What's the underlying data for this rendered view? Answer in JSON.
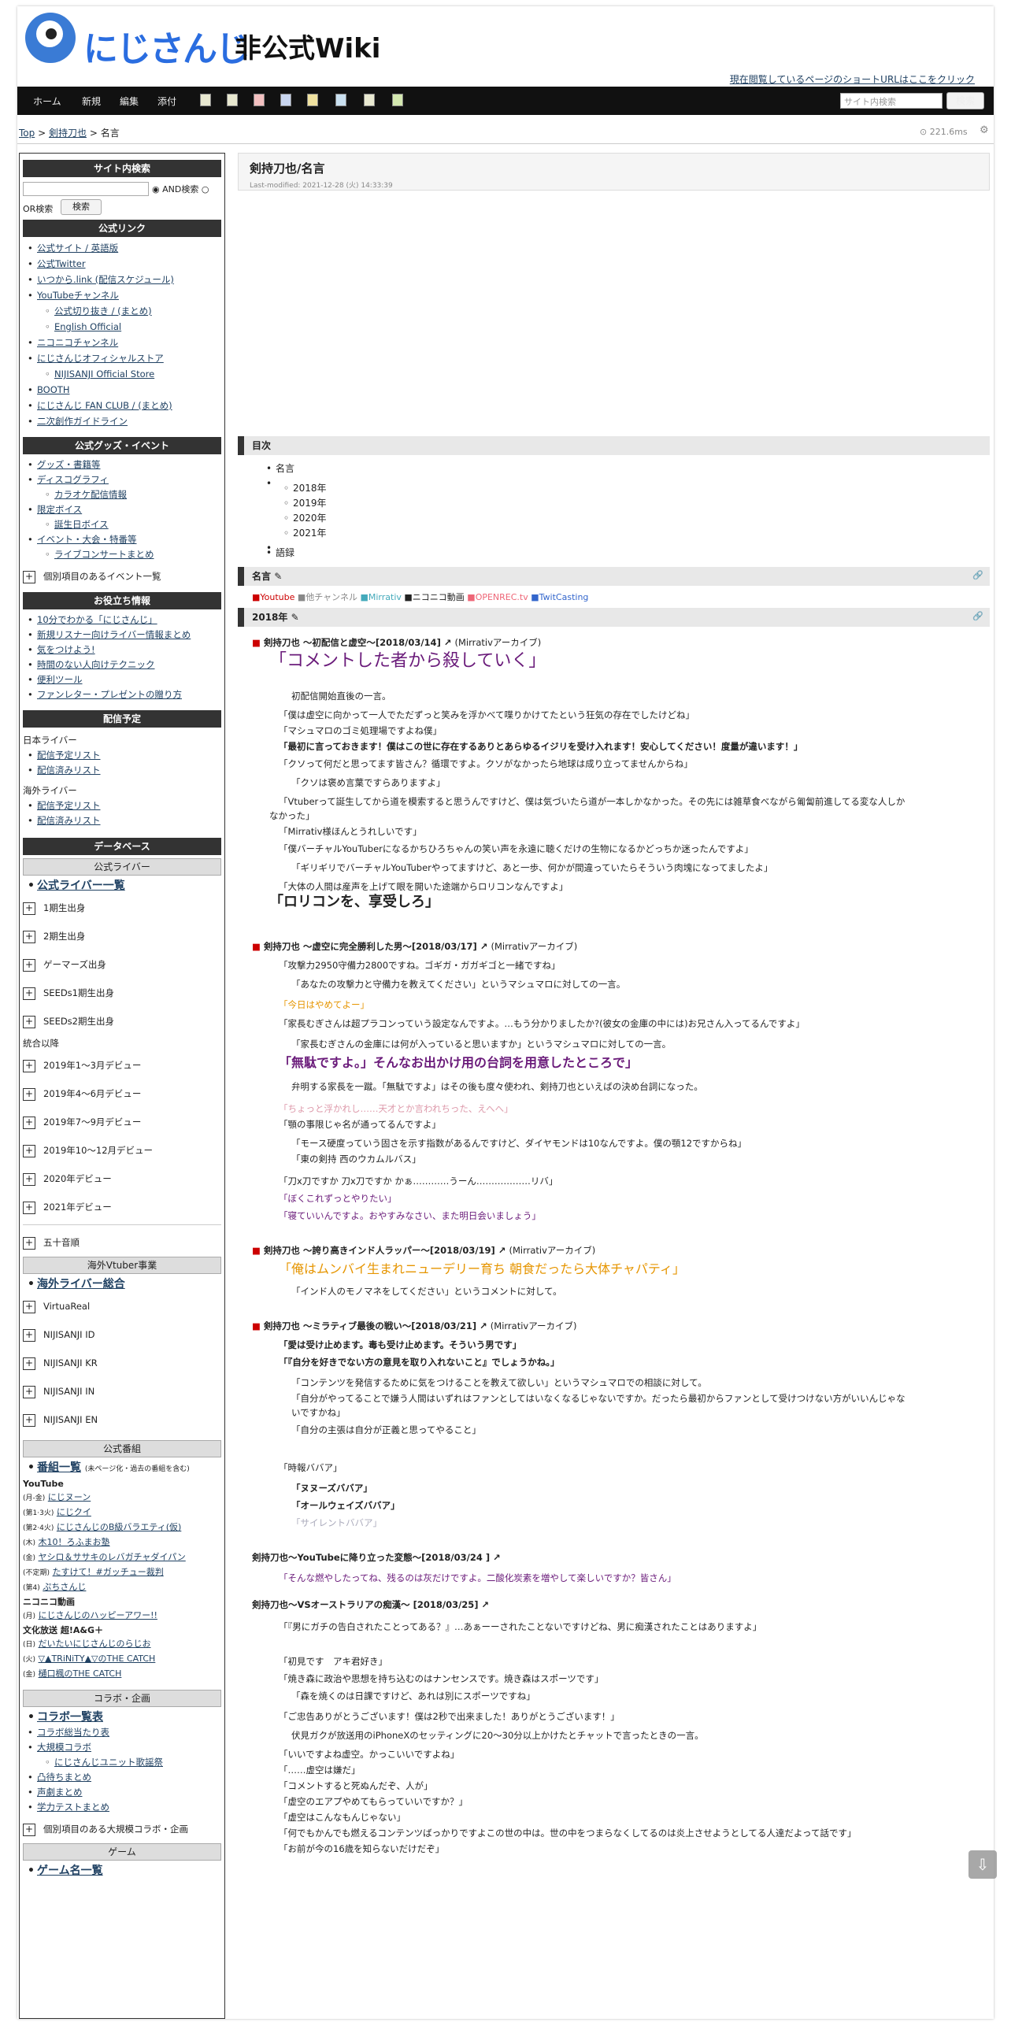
{
  "site": {
    "title_kana": "にじさんじ",
    "title_rest": "非公式Wiki",
    "shorturl": "現在閲覧しているページのショートURLはここをクリック"
  },
  "nav": {
    "items": [
      "ホーム",
      "新規",
      "編集",
      "添付"
    ],
    "search_placeholder": "サイト内検索",
    "search_button": "検索"
  },
  "breadcrumb": {
    "top": "Top",
    "sep": ">",
    "parent": "剣持刀也",
    "current": "名言"
  },
  "perf": "221.6ms",
  "side": {
    "search_title": "サイト内検索",
    "and_label": "AND検索",
    "or_label": "OR検索",
    "search_button": "検索",
    "official_title": "公式リンク",
    "official": [
      "公式サイト / 英語版",
      "公式Twitter",
      "いつから.link (配信スケジュール)",
      "YouTubeチャンネル",
      "公式切り抜き / (まとめ)",
      "English Official",
      "ニコニコチャンネル",
      "にじさんじオフィシャルストア",
      "NIJISANJI Official Store",
      "BOOTH",
      "にじさんじ FAN CLUB / (まとめ)",
      "二次創作ガイドライン"
    ],
    "goods_title": "公式グッズ・イベント",
    "goods": [
      "グッズ・書籍等",
      "ディスコグラフィ",
      "カラオケ配信情報",
      "限定ボイス",
      "誕生日ボイス",
      "イベント・大会・特番等",
      "ライブコンサートまとめ"
    ],
    "goods_exp": "個別項目のあるイベント一覧",
    "info_title": "お役立ち情報",
    "info": [
      "10分でわかる「にじさんじ」",
      "新規リスナー向けライバー情報まとめ",
      "気をつけよう!",
      "時間のない人向けテクニック",
      "便利ツール",
      "ファンレター・プレゼントの贈り方"
    ],
    "sched_title": "配信予定",
    "jp_label": "日本ライバー",
    "overseas_label": "海外ライバー",
    "sched": [
      "配信予定リスト",
      "配信済みリスト"
    ],
    "db_title": "データベース",
    "liver_title": "公式ライバー",
    "liver_all": "公式ライバー一覧",
    "gen": [
      "1期生出身",
      "2期生出身",
      "ゲーマーズ出身",
      "SEEDs1期生出身",
      "SEEDs2期生出身"
    ],
    "merge_label": "統合以降",
    "debut": [
      "2019年1～3月デビュー",
      "2019年4～6月デビュー",
      "2019年7～9月デビュー",
      "2019年10～12月デビュー",
      "2020年デビュー",
      "2021年デビュー"
    ],
    "gojuon": "五十音順",
    "vt_title": "海外Vtuber事業",
    "vt_all": "海外ライバー総合",
    "vt": [
      "VirtuaReal",
      "NIJISANJI ID",
      "NIJISANJI KR",
      "NIJISANJI IN",
      "NIJISANJI EN"
    ],
    "prog_title": "公式番組",
    "prog_all": "番組一覧",
    "prog_note": "(未ページ化・過去の番組を含む)",
    "yt_label": "YouTube",
    "yt": [
      [
        "(月-金)",
        "にじヌーン"
      ],
      [
        "(第1·3火)",
        "にじクイ"
      ],
      [
        "(第2·4火)",
        "にじさんじのB級バラエティ(仮)"
      ],
      [
        "(木)",
        "木10！ろふまお塾"
      ],
      [
        "(金)",
        "ヤシロ＆ササキのレバガチャダイパン"
      ],
      [
        "(不定期)",
        "たすけて！#ガッチュー裁判"
      ],
      [
        "(第4)",
        "ぷちさんじ"
      ]
    ],
    "nico_label": "ニコニコ動画",
    "nico": [
      [
        "(月)",
        "にじさんじのハッピーアワー!!"
      ]
    ],
    "bunka_label": "文化放送 超!A&G＋",
    "bunka": [
      [
        "(日)",
        "だいたいにじさんじのらじお"
      ],
      [
        "(火)",
        "▽▲TRiNiTY▲▽のTHE CATCH"
      ],
      [
        "(金)",
        "樋口楓のTHE CATCH"
      ]
    ],
    "collab_title": "コラボ・企画",
    "collab_all": "コラボ一覧表",
    "collab": [
      "コラボ総当たり表",
      "大規模コラボ",
      "にじさんじユニット歌謡祭",
      "凸待ちまとめ",
      "声劇まとめ",
      "学力テストまとめ"
    ],
    "collab_exp": "個別項目のある大規模コラボ・企画",
    "game_title": "ゲーム",
    "game_all": "ゲーム名一覧"
  },
  "page": {
    "title": "剣持刀也/名言",
    "modified": "Last-modified: 2021-12-28 (火) 14:33:39"
  },
  "toc": {
    "title": "目次",
    "items": [
      "名言",
      "2018年",
      "2019年",
      "2020年",
      "2021年",
      "語録"
    ]
  },
  "legend": [
    "■Youtube",
    "■他チャンネル",
    "■Mirrativ",
    "■ニコニコ動画",
    "■OPENREC.tv",
    "■TwitCasting"
  ],
  "section": "名言",
  "year": "2018年",
  "e1": {
    "title": "剣持刀也 ～初配信と虚空～[2018/03/14]",
    "src": "(Mirrativアーカイブ)",
    "big": "「コメントした者から殺していく」",
    "sub": "初配信開始直後の一言。",
    "l1": "「僕は虚空に向かって一人でただずっと笑みを浮かべて喋りかけてたという狂気の存在でしたけどね」",
    "l2": "「マシュマロのゴミ処理場ですよね僕」",
    "l3": "「最初に言っておきます！僕はこの世に存在するありとあらゆるイジリを受け入れます！安心してください！度量が違います！」",
    "l4": "「クソって何だと思ってます皆さん？循環ですよ。クソがなかったら地球は成り立ってませんからね」",
    "l4s": "「クソは褒め言葉ですらありますよ」",
    "l5": "「Vtuberって誕生してから道を模索すると思うんですけど、僕は気づいたら道が一本しかなかった。その先には雑草食べながら匍匐前進してる変な人しか",
    "l5b": "なかった」",
    "l6": "「Mirrativ様ほんとうれしいです」",
    "l7": "「僕バーチャルYouTuberになるかちひろちゃんの笑い声を永遠に聴くだけの生物になるかどっちか迷ったんですよ」",
    "l7s": "「ギリギリでバーチャルYouTuberやってますけど、あと一歩、何かが間違っていたらそういう肉塊になってましたよ」",
    "l8": "「大体の人間は産声を上げて眼を開いた途端からロリコンなんですよ」",
    "big2": "「ロリコンを、享受しろ」"
  },
  "e2": {
    "title": "剣持刀也 ～虚空に完全勝利した男～[2018/03/17]",
    "src": "(Mirrativアーカイブ)",
    "l1": "「攻撃力2950守備力2800ですね。ゴギガ・ガガギゴと一緒ですね」",
    "l1s": "「あなたの攻撃力と守備力を教えてください」というマシュマロに対しての一言。",
    "l2": "「今日はやめてよー」",
    "l3": "「家長むぎさんは超プラコンっていう設定なんですよ。…もう分かりましたか?(彼女の金庫の中には)お兄さん入ってるんですよ」",
    "l3s": "「家長むぎさんの金庫には何が入っていると思いますか」というマシュマロに対しての一言。",
    "l4": "「無駄ですよ。」そんなお出かけ用の台詞を用意したところで」",
    "l4s": "弁明する家長を一蹴。「無駄ですよ」はその後も度々使われ、剣持刀也といえばの決め台詞になった。",
    "l5": "「ちょっと浮かれし……天才とか言われちった、えへへ」",
    "l6": "「顎の事限じゃ名が通ってるんですよ」",
    "l6a": "「モース硬度っていう固さを示す指数があるんですけど、ダイヤモンドは10なんですよ。僕の顎12ですからね」",
    "l6b": "「東の剣持 西のウカムルバス」",
    "l7": "「刀x刀ですか 刀x刀ですか かぁ…………うーん………………リバ」",
    "l8": "「ぼくこれずっとやりたい」",
    "l9": "「寝ていいんですよ。おやすみなさい、また明日会いましょう」"
  },
  "e3": {
    "title": "剣持刀也 ～誇り高きインド人ラッパー～[2018/03/19]",
    "src": "(Mirrativアーカイブ)",
    "l1": "「俺はムンバイ生まれニューデリー育ち 朝食だったら大体チャパティ」",
    "l1s": "「インド人のモノマネをしてください」というコメントに対して。"
  },
  "e4": {
    "title": "剣持刀也 ～ミラティブ最後の戦い～[2018/03/21]",
    "src": "(Mirrativアーカイブ)",
    "l1": "「愛は受け止めます。毒も受け止めます。そういう男です」",
    "l2": "「『自分を好きでない方の意見を取り入れないこと』でしょうかね。」",
    "l2a": "「コンテンツを発信するために気をつけることを教えて欲しい」というマシュマロでの相談に対して。",
    "l2b": "「自分がやってることで嫌う人間はいずれはファンとしてはいなくなるじゃないですか。だったら最初からファンとして受けつけない方がいいんじゃな",
    "l2c": "いですかね」",
    "l2d": "「自分の主張は自分が正義と思ってやること」",
    "l3": "「時報ババア」",
    "l3a": "「ヌヌーズババア」",
    "l3b": "「オールウェイズババア」",
    "l3c": "「サイレントババア」"
  },
  "e5": {
    "title": "剣持刀也～YouTubeに降り立った変態～[2018/03/24 ]",
    "l1": "「そんな燃やしたってね、残るのは灰だけですよ。二酸化炭素を増やして楽しいですか？皆さん」"
  },
  "e6": {
    "title": "剣持刀也～VSオーストラリアの痴漢～ [2018/03/25]",
    "l1": "「『男にガチの告白されたことってある？』…あぁーーされたことないですけどね、男に痴漢されたことはありますよ」",
    "l2": "「初見です　アキ君好き」",
    "l3": "「焼き森に政治や思想を持ち込むのはナンセンスです。焼き森はスポーツです」",
    "l3s": "「森を焼くのは日課ですけど、あれは別にスポーツですね」",
    "l4": "「ご忠告ありがとうございます！僕は2秒で出来ました！ありがとうございます！」",
    "l4s": "伏見ガクが放送用のiPhoneXのセッティングに20～30分以上かけたとチャットで言ったときの一言。",
    "l5": "「いいですよね虚空。かっこいいですよね」",
    "l6": "「……虚空は嫌だ」",
    "l7": "「コメントすると死ぬんだぞ、人が」",
    "l8": "「虚空のエアプやめてもらっていいですか？」",
    "l9": "「虚空はこんなもんじゃない」",
    "l10": "「何でもかんでも燃えるコンテンツばっかりですよこの世の中は。世の中をつまらなくしてるのは炎上させようとしてる人達だよって話です」",
    "l11": "「お前が今の16歳を知らないだけだぞ」"
  },
  "colors": {
    "nav_bg": "#111111",
    "heading_bg": "#333333",
    "red": "#cc0000",
    "purple": "#6a1b7a",
    "orange": "#e69500"
  }
}
